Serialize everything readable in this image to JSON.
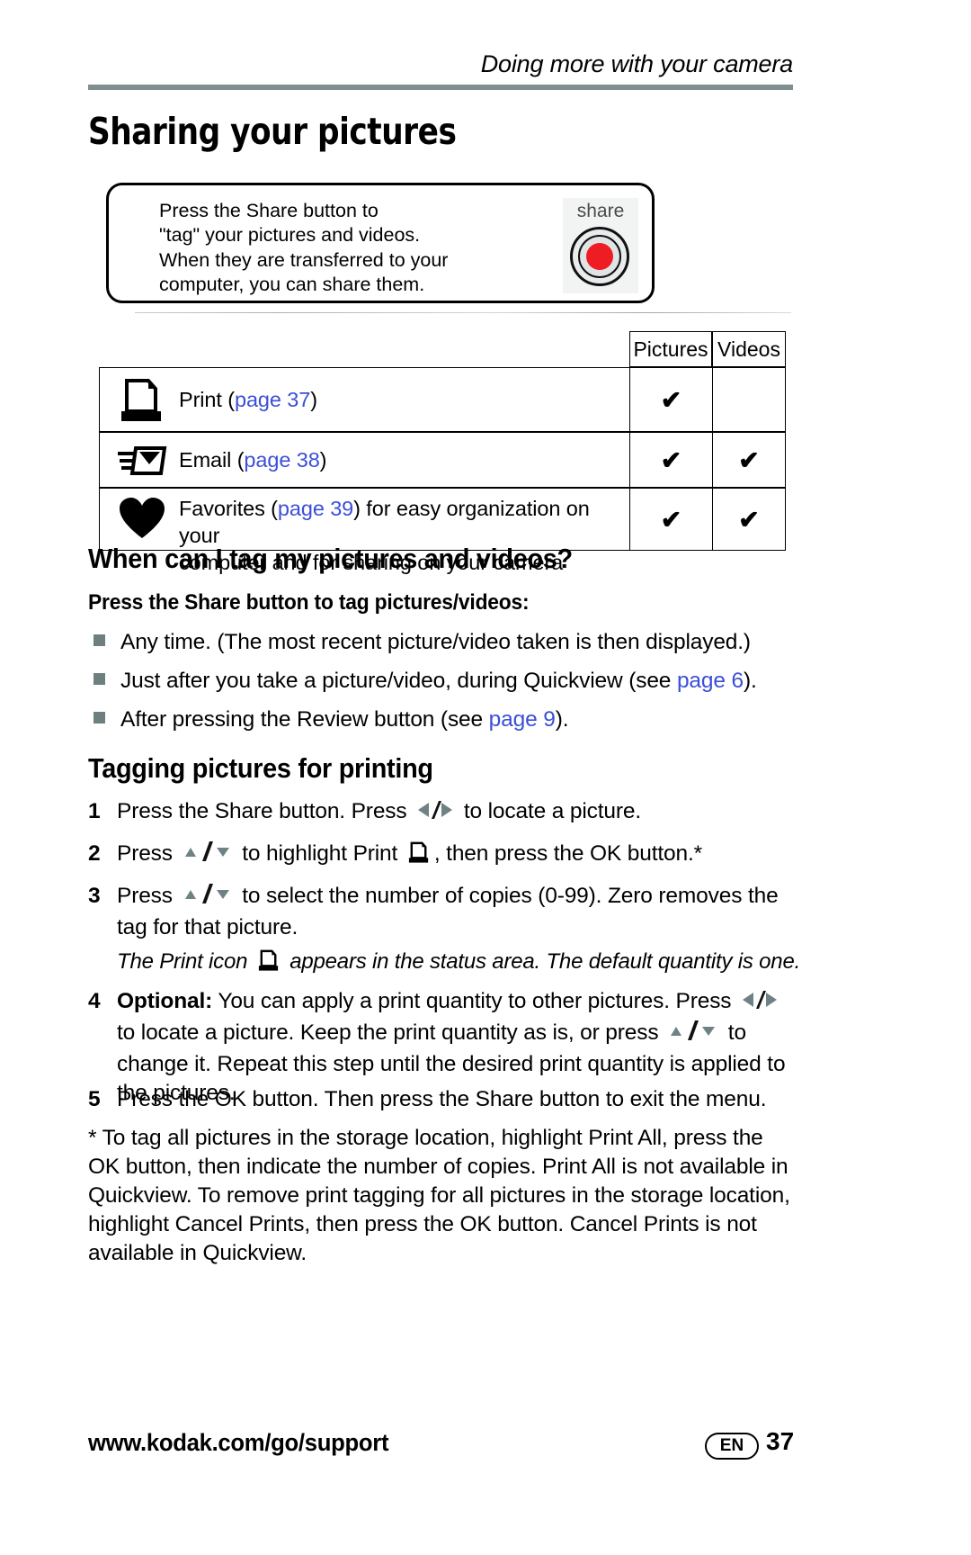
{
  "header": {
    "running_head": "Doing more with your camera",
    "page_title": "Sharing your pictures"
  },
  "callout": {
    "line1": "Press the Share button to",
    "line2": "\"tag\" your pictures and videos.",
    "line3": "When they are transferred to your",
    "line4": "computer, you can share them.",
    "button_label": "share",
    "button_color": "#ee1c23"
  },
  "table": {
    "columns": [
      "",
      "Pictures",
      "Videos"
    ],
    "rows": [
      {
        "icon": "printer-icon",
        "label_prefix": "Print (",
        "link": "page 37",
        "label_suffix": ")",
        "label_line2": "",
        "pictures": "✔",
        "videos": ""
      },
      {
        "icon": "email-icon",
        "label_prefix": "Email (",
        "link": "page 38",
        "label_suffix": ")",
        "label_line2": "",
        "pictures": "✔",
        "videos": "✔"
      },
      {
        "icon": "heart-icon",
        "label_prefix": "Favorites (",
        "link": "page 39",
        "label_suffix": ") for easy organization on your",
        "label_line2": "computer and for sharing on your camera",
        "pictures": "✔",
        "videos": "✔"
      }
    ]
  },
  "section_when": {
    "heading": "When can I tag my pictures and videos?",
    "subheading": "Press the Share button to tag pictures/videos:",
    "bullets": [
      {
        "text": "Any time. (The most recent picture/video taken is then displayed.)",
        "link": "",
        "suffix": ""
      },
      {
        "text": "Just after you take a picture/video, during Quickview (see ",
        "link": "page 6",
        "suffix": ")."
      },
      {
        "text": "After pressing the Review button (see ",
        "link": "page 9",
        "suffix": ")."
      }
    ]
  },
  "section_tagging": {
    "heading": "Tagging pictures for printing",
    "steps": [
      {
        "number": "1",
        "part1": "Press the Share button. Press ",
        "icon1": "left-right-arrows-icon",
        "part2": " to locate a picture.",
        "icon2": "",
        "part3": ""
      },
      {
        "number": "2",
        "part1": "Press ",
        "icon1": "up-down-arrows-icon",
        "part2": " to highlight Print ",
        "icon2": "printer-icon",
        "part3": ", then press the OK button.*"
      },
      {
        "number": "3",
        "part1": "Press ",
        "icon1": "up-down-arrows-icon",
        "part2": " to select the number of copies (0-99). Zero removes the tag for that picture.",
        "icon2": "",
        "part3": ""
      }
    ],
    "italic_note_part1": "The Print icon ",
    "italic_note_icon": "printer-icon",
    "italic_note_part2": " appears in the status area. The default quantity is one.",
    "step4": {
      "number": "4",
      "bold_lead": "Optional:",
      "part1": " You can apply a print quantity to other pictures. Press ",
      "icon1": "left-right-arrows-icon",
      "part2": " to locate a picture. Keep the print quantity as is, or press ",
      "icon2": "up-down-arrows-icon",
      "part3": " to change it. Repeat this step until the desired print quantity is applied to the pictures."
    },
    "step5": {
      "number": "5",
      "text": "Press the OK button. Then press the Share button to exit the menu."
    },
    "footnote": "* To tag all pictures in the storage location, highlight Print All, press the OK button, then indicate the number of copies. Print All is not available in Quickview. To remove print tagging for all pictures in the storage location, highlight Cancel Prints, then press the OK button. Cancel Prints is not available in Quickview."
  },
  "footer": {
    "url": "www.kodak.com/go/support",
    "language_badge": "EN",
    "page_number": "37"
  },
  "colors": {
    "link": "#3b4fd8",
    "rule": "#7f8f8f",
    "bullet": "#6e7f7f",
    "arrow": "#6e8184"
  }
}
